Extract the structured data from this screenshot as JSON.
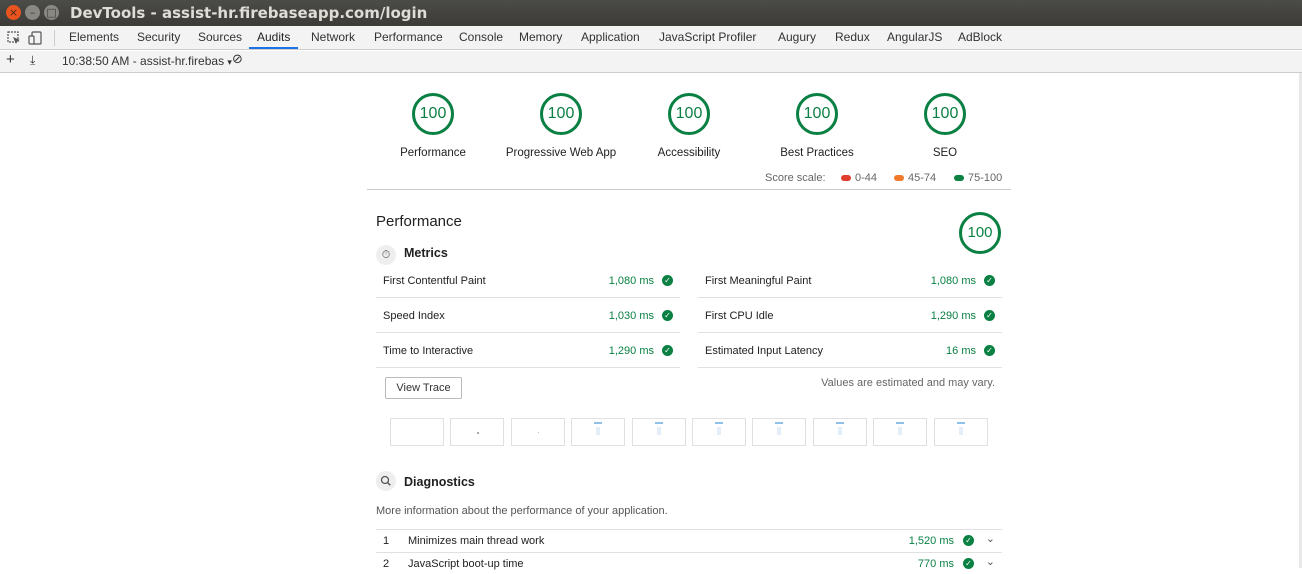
{
  "window": {
    "title": "DevTools - assist-hr.firebaseapp.com/login",
    "close": "×",
    "min": "–",
    "max": "□"
  },
  "tabs": [
    {
      "label": "Elements"
    },
    {
      "label": "Security"
    },
    {
      "label": "Sources"
    },
    {
      "label": "Audits"
    },
    {
      "label": "Network"
    },
    {
      "label": "Performance"
    },
    {
      "label": "Console"
    },
    {
      "label": "Memory"
    },
    {
      "label": "Application"
    },
    {
      "label": "JavaScript Profiler"
    },
    {
      "label": "Augury"
    },
    {
      "label": "Redux"
    },
    {
      "label": "AngularJS"
    },
    {
      "label": "AdBlock"
    }
  ],
  "active_tab": "Audits",
  "toolbar": {
    "add": "+",
    "download": "⤓",
    "report": "10:38:50 AM - assist-hr.firebas",
    "dropdown": "▾",
    "clear": "⊘"
  },
  "categories": [
    {
      "score": "100",
      "label": "Performance"
    },
    {
      "score": "100",
      "label": "Progressive Web App"
    },
    {
      "score": "100",
      "label": "Accessibility"
    },
    {
      "score": "100",
      "label": "Best Practices"
    },
    {
      "score": "100",
      "label": "SEO"
    }
  ],
  "score_scale": {
    "label": "Score scale:",
    "ranges": [
      {
        "range": "0-44",
        "color": "#e13d2d"
      },
      {
        "range": "45-74",
        "color": "#f07a2c"
      },
      {
        "range": "75-100",
        "color": "#0a8043"
      }
    ]
  },
  "performance": {
    "title": "Performance",
    "score": "100",
    "metrics_title": "Metrics",
    "metrics": [
      {
        "label": "First Contentful Paint",
        "value": "1,080 ms"
      },
      {
        "label": "First Meaningful Paint",
        "value": "1,080 ms"
      },
      {
        "label": "Speed Index",
        "value": "1,030 ms"
      },
      {
        "label": "First CPU Idle",
        "value": "1,290 ms"
      },
      {
        "label": "Time to Interactive",
        "value": "1,290 ms"
      },
      {
        "label": "Estimated Input Latency",
        "value": "16 ms"
      }
    ],
    "view_trace": "View Trace",
    "note": "Values are estimated and may vary.",
    "diagnostics_title": "Diagnostics",
    "diagnostics_desc": "More information about the performance of your application.",
    "diagnostics": [
      {
        "num": "1",
        "label": "Minimizes main thread work",
        "value": "1,520 ms"
      },
      {
        "num": "2",
        "label": "JavaScript boot-up time",
        "value": "770 ms"
      }
    ]
  },
  "colors": {
    "pass": "#0a8043",
    "accent": "#1a73e8"
  }
}
